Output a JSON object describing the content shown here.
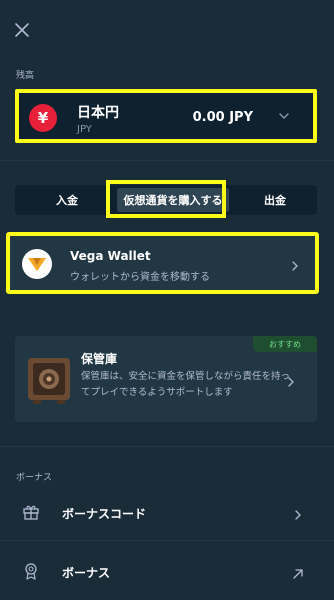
{
  "close": {
    "icon": "close-icon"
  },
  "balance": {
    "section_label": "残高",
    "currency_symbol": "¥",
    "currency_name": "日本円",
    "currency_code": "JPY",
    "amount": "0.00 JPY"
  },
  "tabs": [
    {
      "label": "入金"
    },
    {
      "label": "仮想通貨を購入する"
    },
    {
      "label": "出金"
    }
  ],
  "vega": {
    "title": "Vega Wallet",
    "subtitle": "ウォレットから資金を移動する"
  },
  "vault": {
    "badge": "おすすめ",
    "title": "保管庫",
    "description": "保管庫は、安全に資金を保管しながら責任を持ってプレイできるようサポートします"
  },
  "bonus": {
    "section_label": "ボーナス",
    "items": [
      {
        "label": "ボーナスコード",
        "icon": "gift-icon"
      },
      {
        "label": "ボーナス",
        "icon": "medal-icon"
      }
    ]
  },
  "colors": {
    "background": "#1a2c38",
    "card": "#213743",
    "highlight": "#ffff1a",
    "yen": "#e8203a",
    "vega": "#f5a623"
  }
}
